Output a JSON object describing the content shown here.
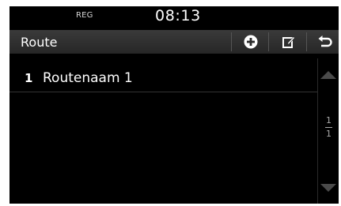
{
  "status": {
    "label": "REG",
    "time": "08:13"
  },
  "header": {
    "title": "Route",
    "buttons": [
      {
        "name": "add",
        "icon": "plus-circle-icon"
      },
      {
        "name": "edit",
        "icon": "edit-icon"
      },
      {
        "name": "back",
        "icon": "back-arrow-icon"
      }
    ]
  },
  "routes": [
    {
      "index": "1",
      "name": "Routenaam 1"
    }
  ],
  "pagination": {
    "current": "1",
    "total": "1"
  },
  "colors": {
    "background": "#000000",
    "titlebar": "#2f2f2f",
    "text": "#ffffff"
  }
}
